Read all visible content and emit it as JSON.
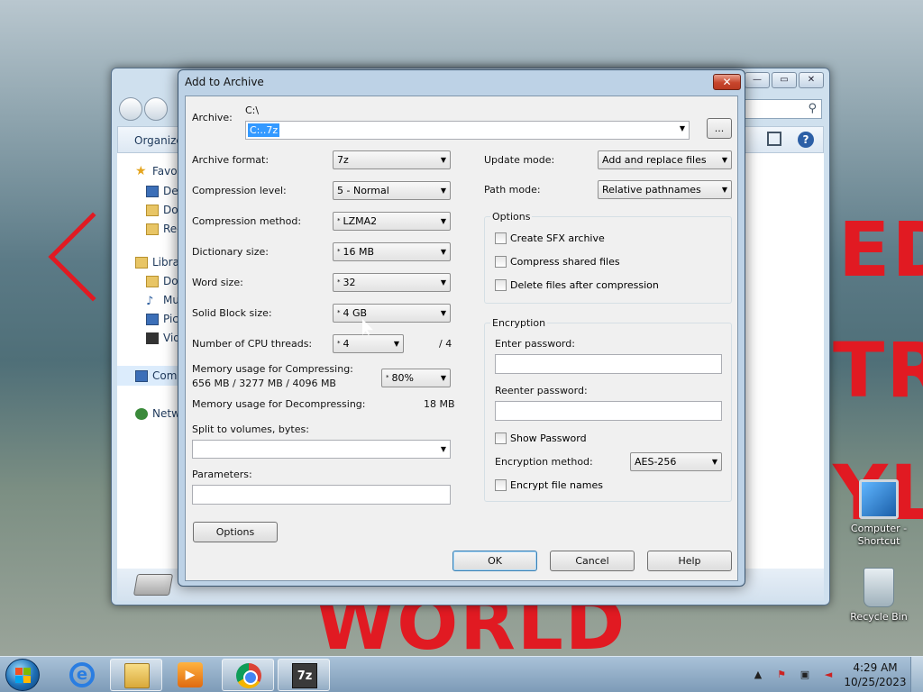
{
  "desktop": {
    "wallpaper_text": [
      "ED",
      "TR",
      "YLI",
      "WORLD"
    ],
    "icons": [
      {
        "label": "Computer -\nShortcut",
        "icon": "computer-icon"
      },
      {
        "label": "Recycle Bin",
        "icon": "recycle-bin-icon"
      }
    ]
  },
  "explorer": {
    "toolbar": {
      "organize": "Organize"
    },
    "nav": {
      "favorites": "Favo",
      "desktop": "Des",
      "downloads": "Dov",
      "recent": "Rec",
      "libraries": "Libra",
      "documents": "Do",
      "music": "Mu",
      "pictures": "Pic",
      "videos": "Vid",
      "computer": "Com",
      "network": "Netw"
    },
    "search_icon": "search-icon"
  },
  "dialog": {
    "title": "Add to Archive",
    "close_label": "✕",
    "archive": {
      "label": "Archive:",
      "folder": "C:\\",
      "value": "C:..7z",
      "browse_label": "..."
    },
    "left": {
      "archive_format": {
        "label": "Archive format:",
        "value": "7z"
      },
      "compression_level": {
        "label": "Compression level:",
        "value": "5 - Normal"
      },
      "compression_method": {
        "label": "Compression method:",
        "value": "LZMA2"
      },
      "dictionary_size": {
        "label": "Dictionary size:",
        "value": "16 MB"
      },
      "word_size": {
        "label": "Word size:",
        "value": "32"
      },
      "solid_block_size": {
        "label": "Solid Block size:",
        "value": "4 GB"
      },
      "cpu_threads": {
        "label": "Number of CPU threads:",
        "value": "4",
        "max": "/ 4"
      },
      "memory_compress": {
        "label": "Memory usage for Compressing:",
        "detail": "656 MB / 3277 MB / 4096 MB",
        "value": "80%"
      },
      "memory_decompress": {
        "label": "Memory usage for Decompressing:",
        "value": "18 MB"
      },
      "split": {
        "label": "Split to volumes, bytes:",
        "value": ""
      },
      "parameters": {
        "label": "Parameters:",
        "value": ""
      },
      "options_button": "Options"
    },
    "right": {
      "update_mode": {
        "label": "Update mode:",
        "value": "Add and replace files"
      },
      "path_mode": {
        "label": "Path mode:",
        "value": "Relative pathnames"
      },
      "options": {
        "title": "Options",
        "create_sfx": "Create SFX archive",
        "compress_shared": "Compress shared files",
        "delete_after": "Delete files after compression"
      },
      "encryption": {
        "title": "Encryption",
        "enter_password": "Enter password:",
        "reenter_password": "Reenter password:",
        "show_password": "Show Password",
        "method_label": "Encryption method:",
        "method_value": "AES-256",
        "encrypt_names": "Encrypt file names"
      }
    },
    "buttons": {
      "ok": "OK",
      "cancel": "Cancel",
      "help": "Help"
    }
  },
  "taskbar": {
    "items": [
      "start-orb",
      "internet-explorer-icon",
      "file-explorer-icon",
      "media-player-icon",
      "chrome-icon",
      "7zip-icon"
    ],
    "sevenzip_label": "7z",
    "time": "4:29 AM",
    "date": "10/25/2023"
  }
}
